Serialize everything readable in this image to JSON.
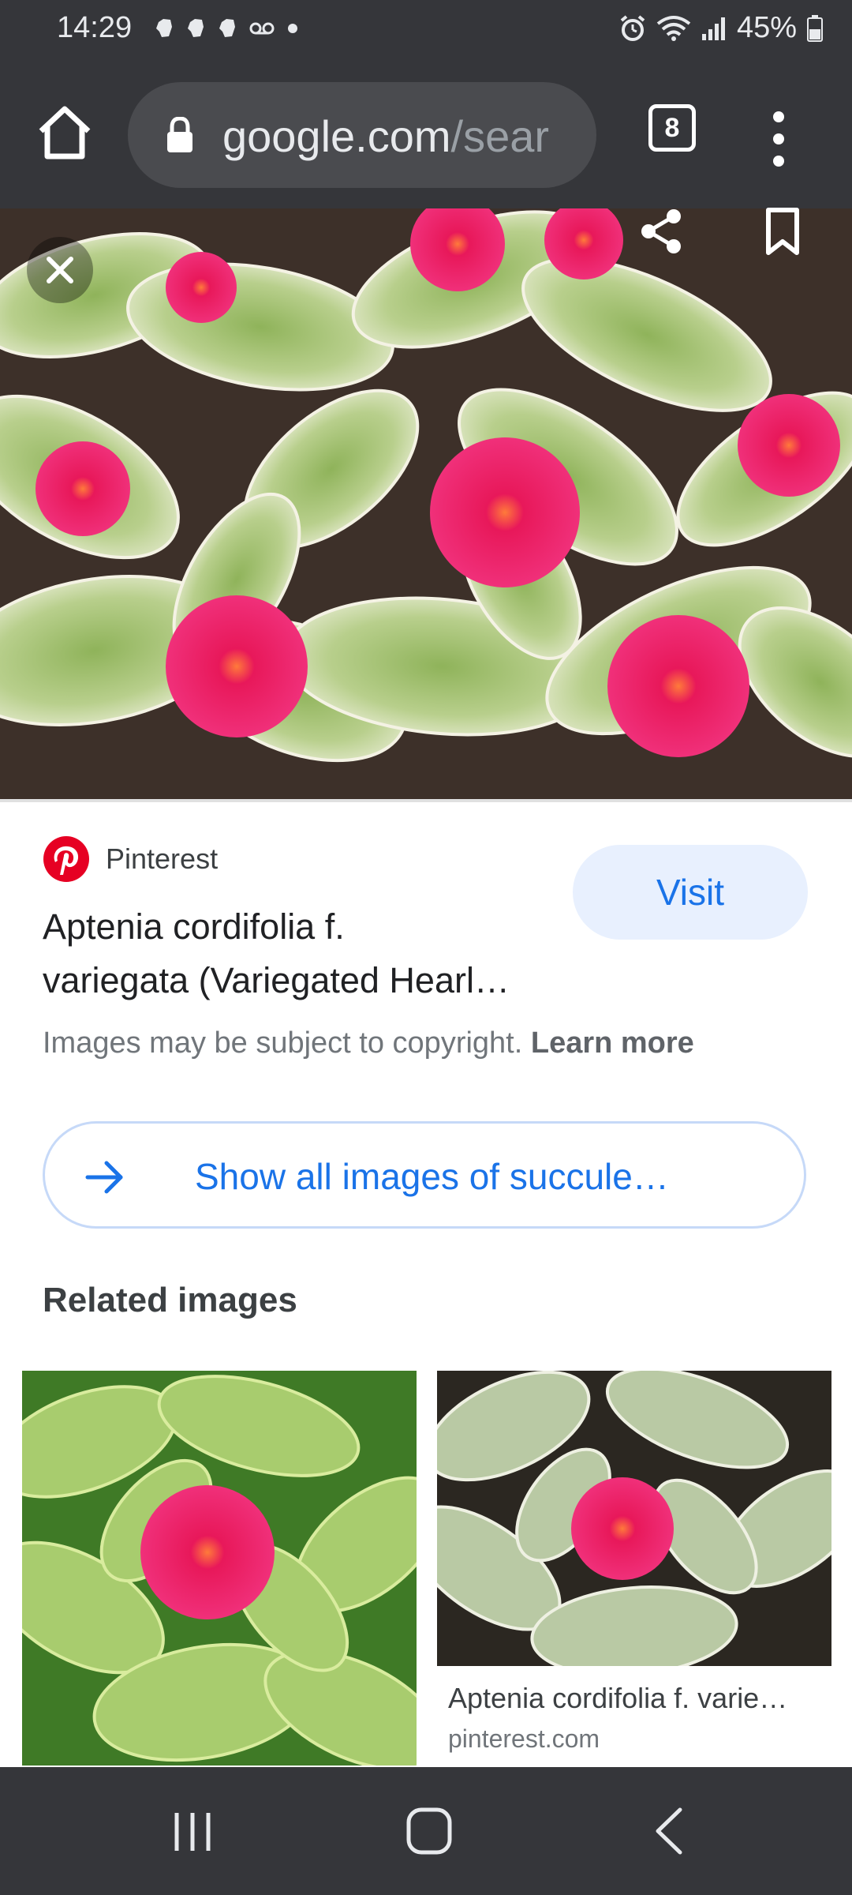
{
  "status_bar": {
    "time": "14:29",
    "battery": "45%",
    "notification_icons": [
      "evernote-icon",
      "evernote-icon",
      "evernote-icon",
      "voicemail-icon",
      "dot-icon"
    ],
    "right_icons": [
      "alarm-icon",
      "wifi-icon",
      "signal-icon",
      "battery-icon"
    ]
  },
  "toolbar": {
    "url_host": "google.com",
    "url_rest": "/sear",
    "tab_count": "8"
  },
  "image_viewer": {
    "source_name": "Pinterest",
    "visit_label": "Visit",
    "title_line1": "Aptenia cordifolia f.",
    "title_line2": "variegata (Variegated Hearl…",
    "copyright_text": "Images may be subject to copyright. ",
    "learn_more_label": "Learn more",
    "show_all_label": "Show all images of succule…"
  },
  "related": {
    "heading": "Related images",
    "items": [
      {
        "caption": "",
        "source": ""
      },
      {
        "caption": "Aptenia cordifolia f. varie…",
        "source": "pinterest.com"
      }
    ]
  },
  "colors": {
    "chrome_bg": "#35363a",
    "accent_blue": "#1a73e8",
    "visit_bg": "#e8f0fe",
    "pinterest_red": "#e60023",
    "flower_pink": "#e8185a"
  }
}
